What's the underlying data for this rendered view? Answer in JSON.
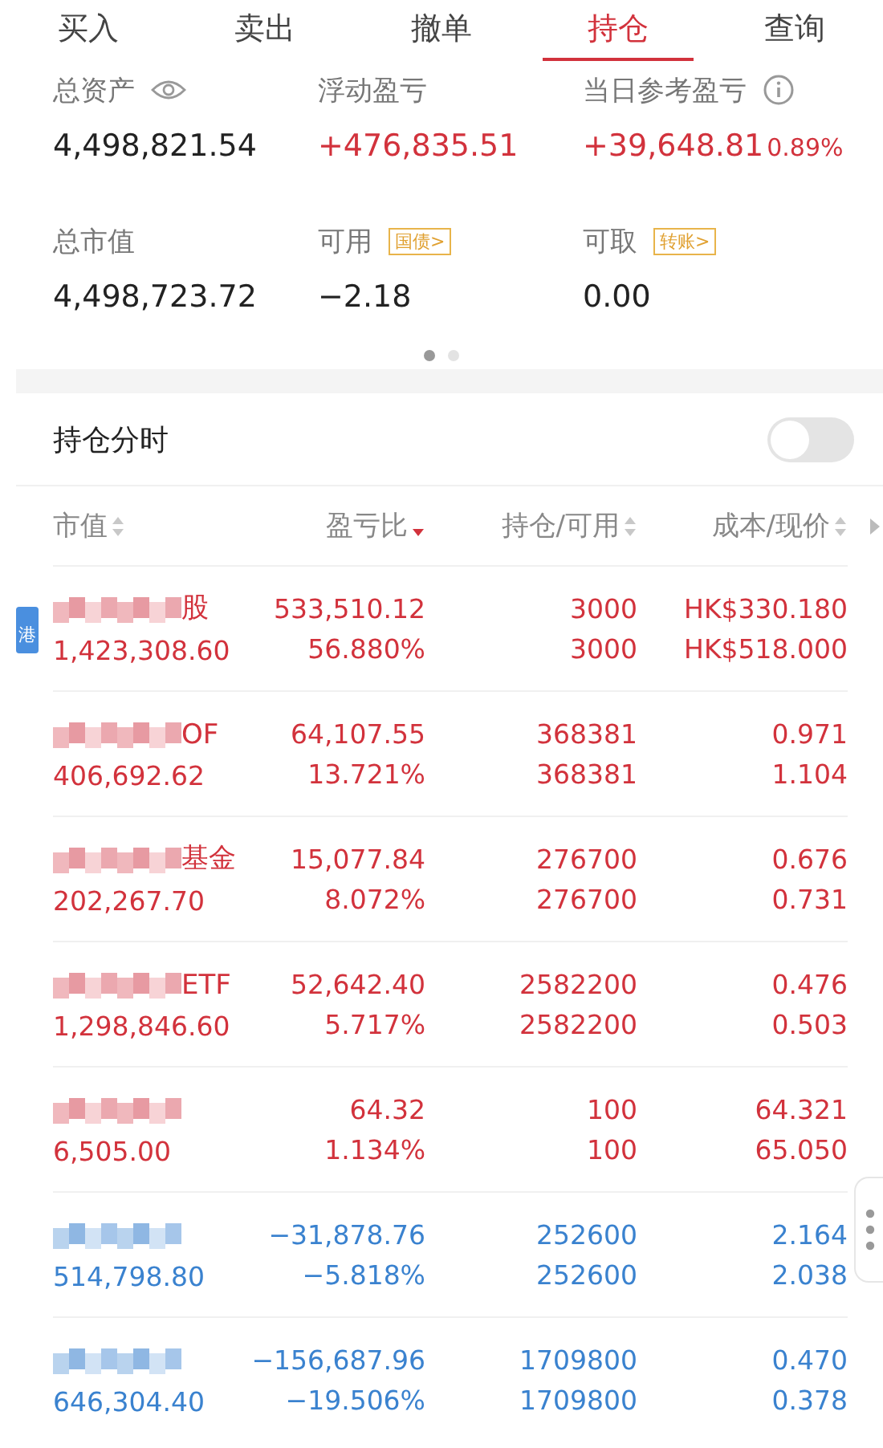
{
  "tabs": [
    {
      "label": "买入",
      "selected": false
    },
    {
      "label": "卖出",
      "selected": false
    },
    {
      "label": "撤单",
      "selected": false
    },
    {
      "label": "持仓",
      "selected": true
    },
    {
      "label": "查询",
      "selected": false
    }
  ],
  "summary": [
    {
      "label": "总资产",
      "kind": "eye",
      "value": "4,498,821.54",
      "gain": false
    },
    {
      "label": "浮动盈亏",
      "kind": "plain",
      "value": "+476,835.51",
      "gain": true
    },
    {
      "label": "当日参考盈亏",
      "kind": "info",
      "value": "+39,648.81",
      "percent": "0.89%",
      "gain": true
    },
    {
      "label": "总市值",
      "kind": "plain",
      "value": "4,498,723.72",
      "gain": false
    },
    {
      "label": "可用",
      "kind": "tag",
      "tag": "国债>",
      "value": "−2.18",
      "gain": false
    },
    {
      "label": "可取",
      "kind": "tag",
      "tag": "转账>",
      "value": "0.00",
      "gain": false
    }
  ],
  "pages": [
    {
      "selected": true
    },
    {
      "selected": false
    }
  ],
  "toggle": {
    "label": "持仓分时",
    "on": false
  },
  "columns": [
    {
      "label": "市值",
      "selected": false
    },
    {
      "label": "盈亏比",
      "selected": true
    },
    {
      "label": "持仓/可用",
      "selected": false
    },
    {
      "label": "成本/现价",
      "selected": false
    }
  ],
  "rows": [
    {
      "name": "股",
      "market": "港",
      "market_value": "1,423,308.60",
      "pnl": "533,510.12",
      "pnl_ratio": "56.880%",
      "holding": "3000",
      "available": "3000",
      "cost": "HK$330.180",
      "price": "HK$518.000",
      "gain": true
    },
    {
      "name": "OF",
      "market_value": "406,692.62",
      "pnl": "64,107.55",
      "pnl_ratio": "13.721%",
      "holding": "368381",
      "available": "368381",
      "cost": "0.971",
      "price": "1.104",
      "gain": true
    },
    {
      "name": "基金",
      "market_value": "202,267.70",
      "pnl": "15,077.84",
      "pnl_ratio": "8.072%",
      "holding": "276700",
      "available": "276700",
      "cost": "0.676",
      "price": "0.731",
      "gain": true
    },
    {
      "name": "ETF",
      "market_value": "1,298,846.60",
      "pnl": "52,642.40",
      "pnl_ratio": "5.717%",
      "holding": "2582200",
      "available": "2582200",
      "cost": "0.476",
      "price": "0.503",
      "gain": true
    },
    {
      "market_value": "6,505.00",
      "pnl": "64.32",
      "pnl_ratio": "1.134%",
      "holding": "100",
      "available": "100",
      "cost": "64.321",
      "price": "65.050",
      "gain": true
    },
    {
      "market_value": "514,798.80",
      "pnl": "−31,878.76",
      "pnl_ratio": "−5.818%",
      "holding": "252600",
      "available": "252600",
      "cost": "2.164",
      "price": "2.038",
      "gain": false
    },
    {
      "market_value": "646,304.40",
      "pnl": "−156,687.96",
      "pnl_ratio": "−19.506%",
      "holding": "1709800",
      "available": "1709800",
      "cost": "0.470",
      "price": "0.378",
      "gain": false
    }
  ]
}
